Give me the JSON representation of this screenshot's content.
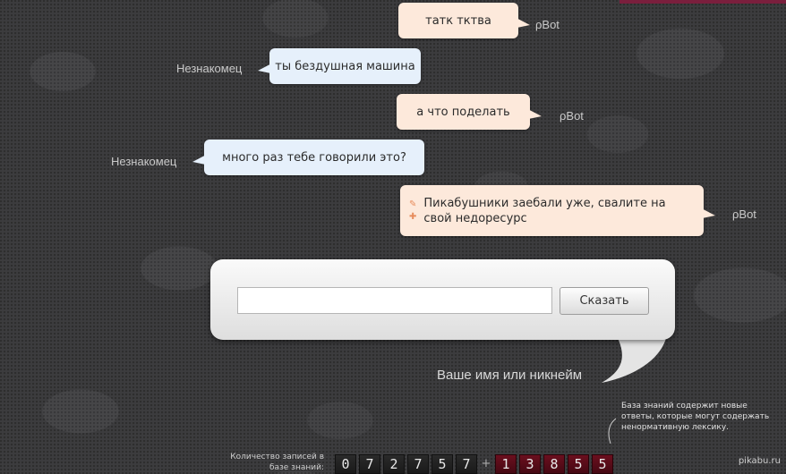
{
  "messages": [
    {
      "speaker": "ρBot",
      "role": "bot",
      "text": "татк тктва"
    },
    {
      "speaker": "Незнакомец",
      "role": "user",
      "text": "ты бездушная машина"
    },
    {
      "speaker": "ρBot",
      "role": "bot",
      "text": "а что поделать"
    },
    {
      "speaker": "Незнакомец",
      "role": "user",
      "text": "много раз тебе говорили это?"
    },
    {
      "speaker": "ρBot",
      "role": "bot",
      "text": "Пикабушники заебали уже, свалите на свой недоресурс",
      "has_tools": true
    }
  ],
  "input": {
    "value": "",
    "placeholder": "",
    "button_label": "Сказать",
    "name_hint": "Ваше имя или никнейм"
  },
  "knowledge_note": "База знаний содержит новые ответы, которые могут содержать ненормативную лексику.",
  "records": {
    "label": "Количество записей в базе знаний:",
    "base_digits": [
      "0",
      "7",
      "2",
      "7",
      "5",
      "7"
    ],
    "plus": "+",
    "new_digits": [
      "1",
      "3",
      "8",
      "5",
      "5"
    ]
  },
  "watermark": "pikabu.ru",
  "colors": {
    "bot_bubble": "#fde9db",
    "user_bubble": "#e6f0fb",
    "background": "#3c3c3e",
    "new_digit": "#6b0f1e"
  },
  "icons": [
    "edit-icon",
    "add-icon"
  ]
}
